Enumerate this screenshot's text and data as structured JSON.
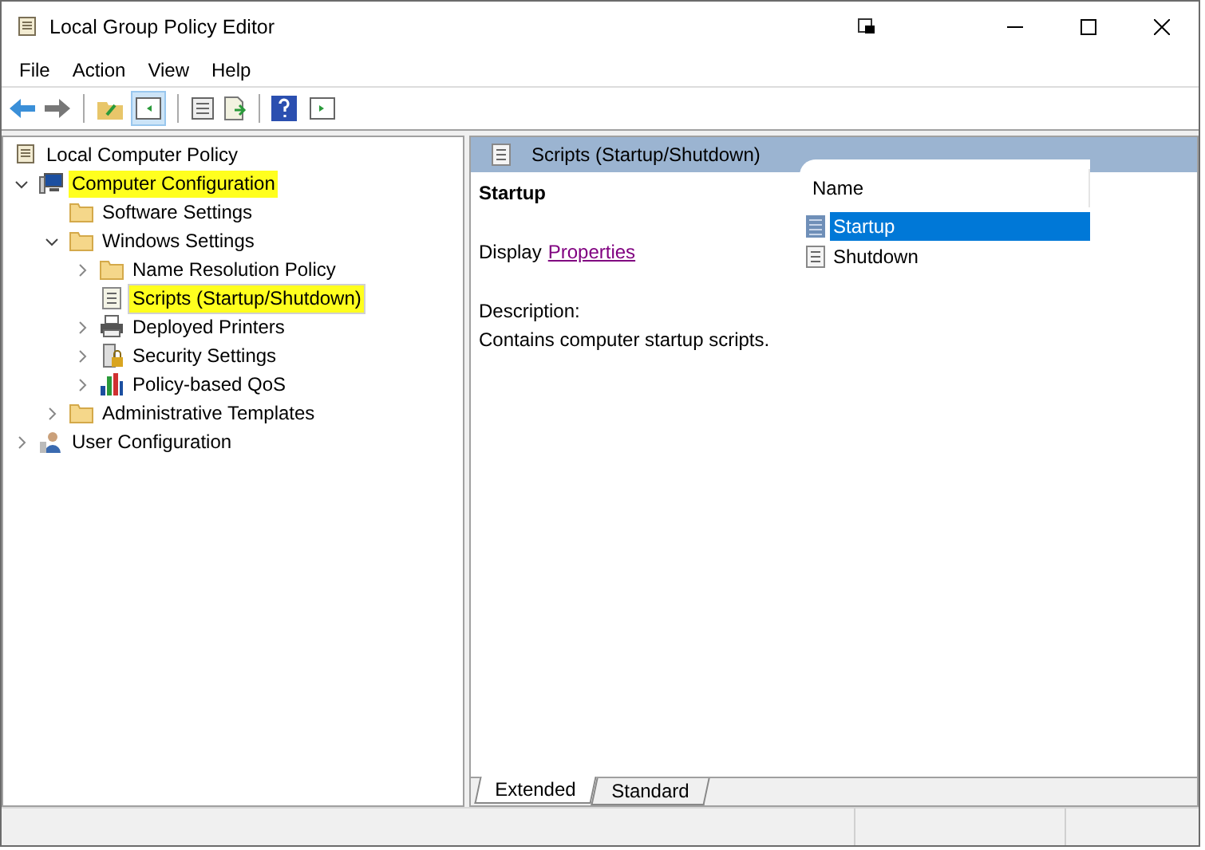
{
  "window": {
    "title": "Local Group Policy Editor"
  },
  "menu": [
    "File",
    "Action",
    "View",
    "Help"
  ],
  "tree": [
    {
      "label": "Local Computer Policy",
      "kind": "policy",
      "selected": false,
      "highlighted": false,
      "children": [
        {
          "label": "Computer Configuration",
          "kind": "computer",
          "expanded": true,
          "selected": false,
          "highlighted": true,
          "children": [
            {
              "label": "Software Settings",
              "kind": "folder",
              "selected": false,
              "highlighted": false
            },
            {
              "label": "Windows Settings",
              "kind": "folder",
              "expanded": true,
              "selected": false,
              "highlighted": false,
              "children": [
                {
                  "label": "Name Resolution Policy",
                  "kind": "folder",
                  "expanded": false,
                  "selected": false,
                  "highlighted": false
                },
                {
                  "label": "Scripts (Startup/Shutdown)",
                  "kind": "script",
                  "selected": true,
                  "highlighted": true
                },
                {
                  "label": "Deployed Printers",
                  "kind": "printer",
                  "expanded": false,
                  "selected": false,
                  "highlighted": false
                },
                {
                  "label": "Security Settings",
                  "kind": "security",
                  "expanded": false,
                  "selected": false,
                  "highlighted": false
                },
                {
                  "label": "Policy-based QoS",
                  "kind": "chart",
                  "expanded": false,
                  "selected": false,
                  "highlighted": false
                }
              ]
            },
            {
              "label": "Administrative Templates",
              "kind": "folder",
              "expanded": false,
              "selected": false,
              "highlighted": false
            }
          ]
        },
        {
          "label": "User Configuration",
          "kind": "user",
          "expanded": false,
          "selected": false,
          "highlighted": false
        }
      ]
    }
  ],
  "details": {
    "header": "Scripts (Startup/Shutdown)",
    "heading": "Startup",
    "display_label": "Display",
    "link": "Properties",
    "description_label": "Description:",
    "description": "Contains computer startup scripts."
  },
  "list": {
    "column": "Name",
    "items": [
      {
        "label": "Startup",
        "selected": true
      },
      {
        "label": "Shutdown",
        "selected": false
      }
    ]
  },
  "tabs": [
    {
      "label": "Extended",
      "selected": true
    },
    {
      "label": "Standard",
      "selected": false
    }
  ]
}
